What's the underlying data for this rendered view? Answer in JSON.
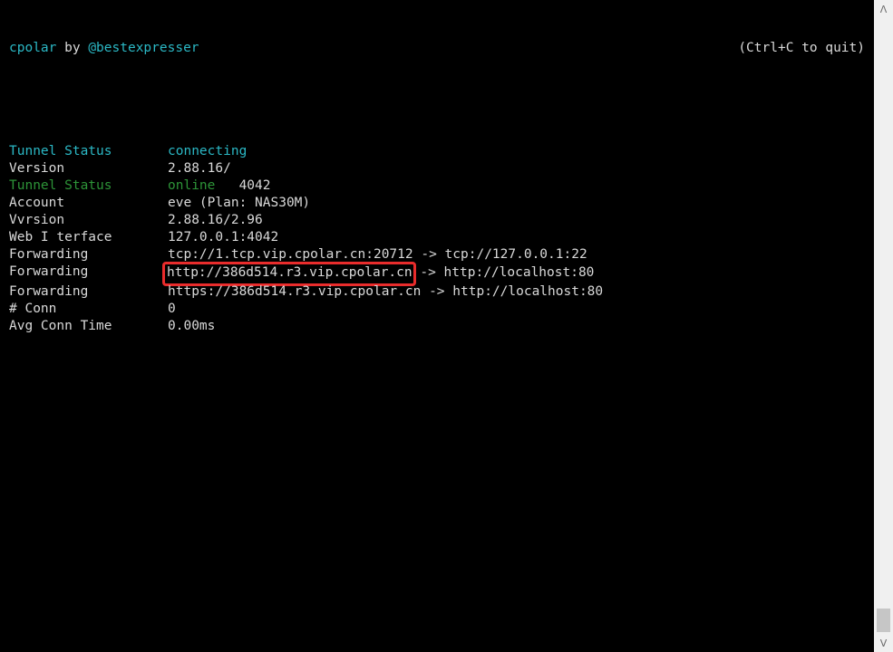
{
  "header": {
    "app_name": "cpolar",
    "by": " by ",
    "author": "@bestexpresser",
    "quit_hint": "(Ctrl+C to quit)"
  },
  "rows": [
    {
      "label": "Tunnel Status",
      "label_class": "cyan",
      "value": "connecting",
      "value_class": "cyan"
    },
    {
      "label": "Version",
      "label_class": "white",
      "value": "2.88.16/",
      "value_class": "white"
    },
    {
      "label": "Tunnel Status",
      "label_class": "green",
      "value": "online",
      "value_class": "green",
      "suffix": "   4042"
    },
    {
      "label": "Account",
      "label_class": "white",
      "value": "eve (Plan: NAS30M)",
      "value_class": "white"
    },
    {
      "label": "Vvrsion",
      "label_class": "white",
      "value": "2.88.16/2.96",
      "value_class": "white"
    },
    {
      "label": "Web I terface",
      "label_class": "white",
      "value": "127.0.0.1:4042",
      "value_class": "white"
    },
    {
      "label": "Forwarding",
      "label_class": "white",
      "value": "tcp://1.tcp.vip.cpolar.cn:20712 -> tcp://127.0.0.1:22",
      "value_class": "white"
    },
    {
      "label": "Forwarding",
      "label_class": "white",
      "value_pre": "http://386d514.r3.vip.cpolar.cn",
      "value_post": " -> http://localhost:80",
      "highlight": true
    },
    {
      "label": "Forwarding",
      "label_class": "white",
      "value": "https://386d514.r3.vip.cpolar.cn -> http://localhost:80",
      "value_class": "white"
    },
    {
      "label": "# Conn",
      "label_class": "white",
      "value": "0",
      "value_class": "white"
    },
    {
      "label": "Avg Conn Time",
      "label_class": "white",
      "value": "0.00ms",
      "value_class": "white"
    }
  ]
}
